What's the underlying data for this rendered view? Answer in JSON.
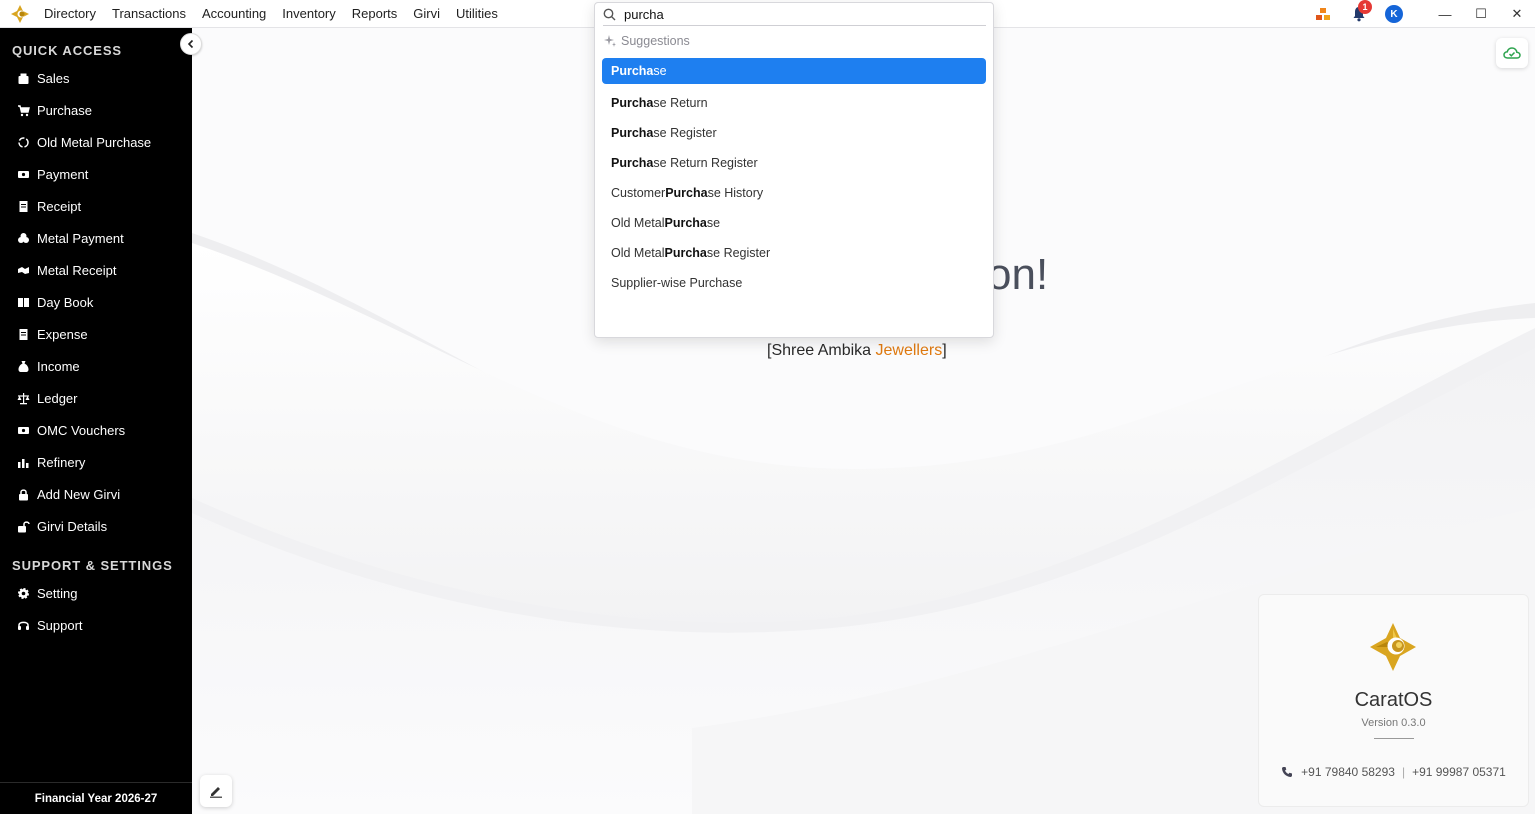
{
  "menu": [
    "Directory",
    "Transactions",
    "Accounting",
    "Inventory",
    "Reports",
    "Girvi",
    "Utilities"
  ],
  "topbar": {
    "notification_count": "1",
    "avatar_letter": "K",
    "window_controls": [
      "minimize-icon",
      "maximize-icon",
      "close-icon"
    ]
  },
  "sidebar": {
    "quick_access_title": "QUICK ACCESS",
    "quick_access": [
      {
        "label": "Sales",
        "icon": "sales-icon"
      },
      {
        "label": "Purchase",
        "icon": "cart-icon"
      },
      {
        "label": "Old Metal Purchase",
        "icon": "recycle-icon"
      },
      {
        "label": "Payment",
        "icon": "money-icon"
      },
      {
        "label": "Receipt",
        "icon": "receipt-icon"
      },
      {
        "label": "Metal Payment",
        "icon": "coins-icon"
      },
      {
        "label": "Metal Receipt",
        "icon": "handshake-icon"
      },
      {
        "label": "Day Book",
        "icon": "book-icon"
      },
      {
        "label": "Expense",
        "icon": "invoice-icon"
      },
      {
        "label": "Income",
        "icon": "money-bag-icon"
      },
      {
        "label": "Ledger",
        "icon": "scale-icon"
      },
      {
        "label": "OMC Vouchers",
        "icon": "voucher-icon"
      },
      {
        "label": "Refinery",
        "icon": "chart-icon"
      },
      {
        "label": "Add New Girvi",
        "icon": "lock-icon"
      },
      {
        "label": "Girvi Details",
        "icon": "unlock-icon"
      }
    ],
    "support_title": "SUPPORT & SETTINGS",
    "support": [
      {
        "label": "Setting",
        "icon": "gear-icon"
      },
      {
        "label": "Support",
        "icon": "headset-icon"
      }
    ],
    "footer": "Financial Year 2026-27"
  },
  "search": {
    "value": "purcha",
    "suggestions_label": "Suggestions",
    "suggestions": [
      {
        "pre": "",
        "match": "Purcha",
        "post": "se"
      },
      {
        "pre": "",
        "match": "Purcha",
        "post": "se Return"
      },
      {
        "pre": "",
        "match": "Purcha",
        "post": "se Register"
      },
      {
        "pre": "",
        "match": "Purcha",
        "post": "se Return Register"
      },
      {
        "pre": "Customer ",
        "match": "Purcha",
        "post": "se History"
      },
      {
        "pre": "Old Metal ",
        "match": "Purcha",
        "post": "se"
      },
      {
        "pre": "Old Metal ",
        "match": "Purcha",
        "post": "se Register"
      },
      {
        "pre": "Supplier-wise Purchase",
        "match": "",
        "post": ""
      }
    ]
  },
  "main": {
    "welcome_visible": "on!",
    "company_prefix": "[Shree Ambika ",
    "company_accent": "Jewellers",
    "company_suffix": "]"
  },
  "about": {
    "name": "CaratOS",
    "version": "Version 0.3.0",
    "phone1": "+91 79840 58293",
    "separator": "|",
    "phone2": "+91 99987 05371"
  },
  "colors": {
    "accent_blue": "#1e7ff0",
    "brand_orange": "#e07a10",
    "sidebar_bg": "#000000",
    "cloud_green": "#2ea44f"
  }
}
